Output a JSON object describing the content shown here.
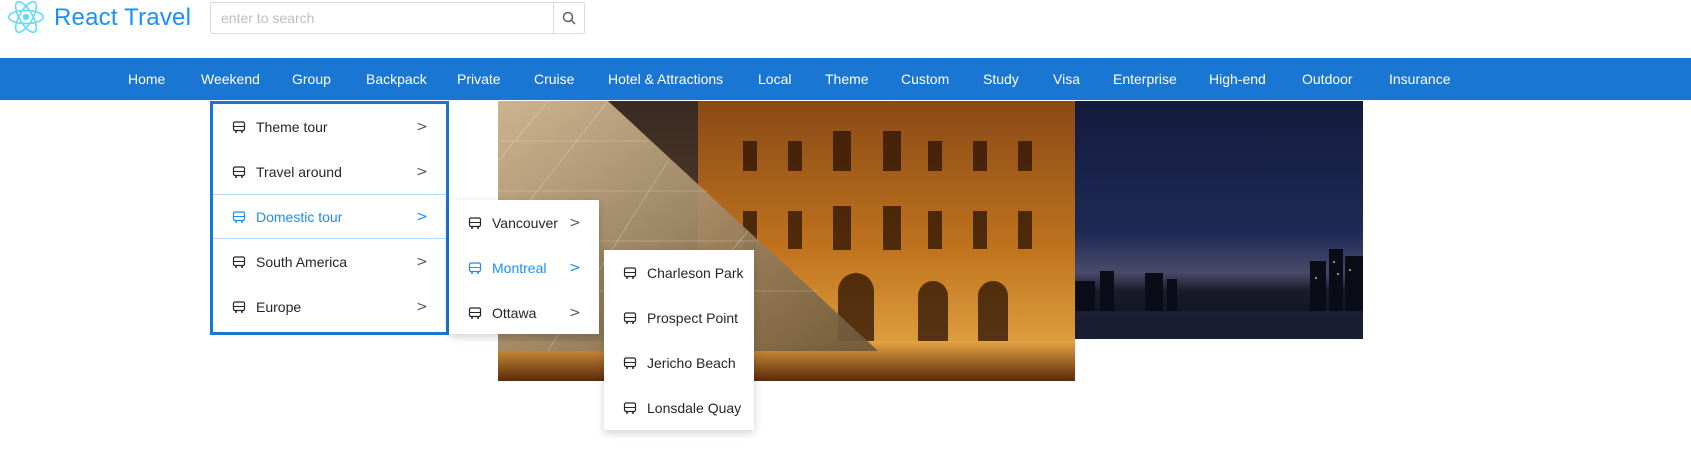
{
  "header": {
    "brand": "React Travel",
    "search": {
      "placeholder": "enter to search",
      "value": ""
    }
  },
  "nav": {
    "items": [
      "Home",
      "Weekend",
      "Group",
      "Backpack",
      "Private",
      "Cruise",
      "Hotel & Attractions",
      "Local",
      "Theme",
      "Custom",
      "Study",
      "Visa",
      "Enterprise",
      "High-end",
      "Outdoor",
      "Insurance"
    ]
  },
  "menu": {
    "items": [
      {
        "label": "Theme tour",
        "icon": "bus-icon",
        "arrow": ">"
      },
      {
        "label": "Travel around",
        "icon": "bus-icon",
        "arrow": ">"
      },
      {
        "label": "Domestic tour",
        "icon": "bus-icon",
        "arrow": ">"
      },
      {
        "label": "South America",
        "icon": "bus-icon",
        "arrow": ">"
      },
      {
        "label": "Europe",
        "icon": "bus-icon",
        "arrow": ">"
      }
    ],
    "submenu": {
      "items": [
        {
          "label": "Vancouver",
          "icon": "bus-icon",
          "arrow": ">"
        },
        {
          "label": "Montreal",
          "icon": "bus-icon",
          "arrow": ">"
        },
        {
          "label": "Ottawa",
          "icon": "bus-icon",
          "arrow": ">"
        }
      ]
    },
    "submenu2": {
      "items": [
        {
          "label": "Charleson Park",
          "icon": "bus-icon"
        },
        {
          "label": "Prospect Point",
          "icon": "bus-icon"
        },
        {
          "label": "Jericho Beach",
          "icon": "bus-icon"
        },
        {
          "label": "Lonsdale Quay",
          "icon": "bus-icon"
        }
      ]
    }
  },
  "colors": {
    "brand": "#1890ff",
    "navbar": "#1976d2",
    "active": "#1890ff"
  }
}
